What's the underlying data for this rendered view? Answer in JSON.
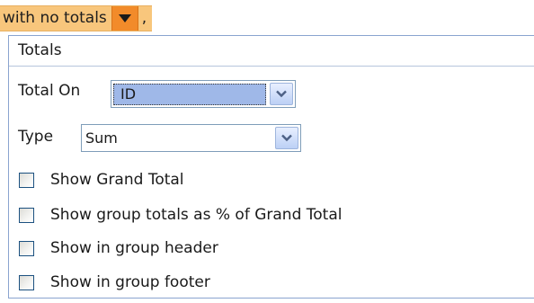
{
  "chip": {
    "label": "with no totals",
    "suffix": ","
  },
  "panel": {
    "title": "Totals",
    "total_on": {
      "label": "Total On",
      "value": "ID"
    },
    "type": {
      "label": "Type",
      "value": "Sum"
    },
    "options": [
      {
        "label": "Show Grand Total",
        "checked": false
      },
      {
        "label": "Show group totals as % of Grand Total",
        "checked": false
      },
      {
        "label": "Show in group header",
        "checked": false
      },
      {
        "label": "Show in group footer",
        "checked": false
      }
    ]
  },
  "colors": {
    "chip_background": "#f8c67c",
    "chip_dropdown": "#f28b2a",
    "panel_border": "#8aa4cf",
    "selected_value": "#9fb8e8"
  },
  "icons": {
    "chip_dropdown": "caret-down-icon",
    "select_dropdown": "chevron-down-icon"
  }
}
